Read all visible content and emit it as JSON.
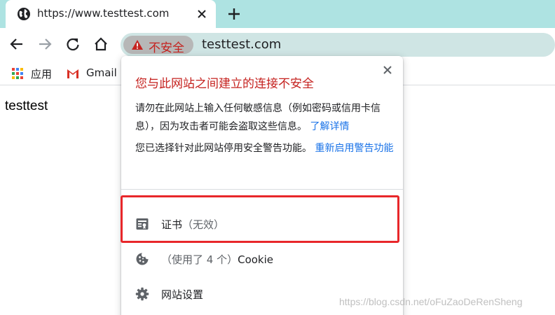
{
  "tab": {
    "title": "https://www.testtest.com",
    "favicon": "globe-icon"
  },
  "toolbar": {
    "back": "arrow-left-icon",
    "forward": "arrow-right-icon",
    "reload": "reload-icon",
    "home": "home-icon",
    "security_chip": "不安全",
    "url": "testtest.com"
  },
  "bookmarks": [
    {
      "label": "应用",
      "icon": "apps-grid-icon"
    },
    {
      "label": "Gmail",
      "icon": "gmail-icon"
    }
  ],
  "page": {
    "body_text": "testtest"
  },
  "popup": {
    "title": "您与此网站之间建立的连接不安全",
    "desc_text": "请勿在此网站上输入任何敏感信息（例如密码或信用卡信息），因为攻击者可能会盗取这些信息。",
    "desc_link": "了解详情",
    "desc2_text": "您已选择针对此网站停用安全警告功能。",
    "desc2_link": "重新启用警告功能",
    "rows": [
      {
        "label": "证书",
        "suffix": "（无效）",
        "icon": "certificate-icon"
      },
      {
        "prefix": "（使用了 4 个）",
        "label": "Cookie",
        "icon": "cookie-icon"
      },
      {
        "label": "网站设置",
        "icon": "gear-icon"
      }
    ]
  },
  "watermark": "https://blog.csdn.net/oFuZaoDeRenSheng",
  "colors": {
    "tabstrip": "#aee3e2",
    "omnibox": "#cfe5e4",
    "warning_red": "#c5221f",
    "link_blue": "#1a73e8",
    "highlight_red": "#e8272a"
  }
}
